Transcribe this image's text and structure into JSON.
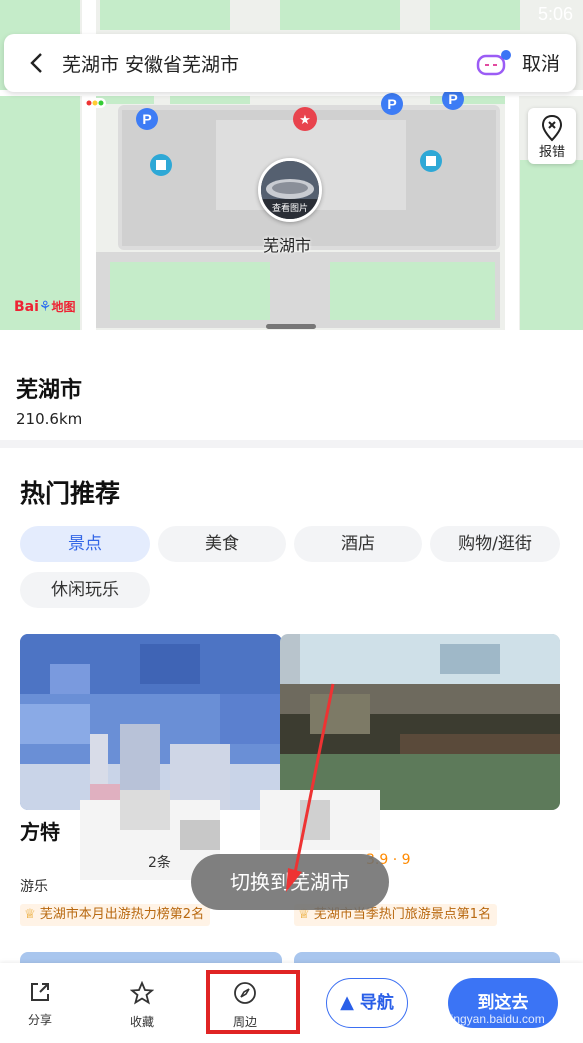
{
  "status": {
    "time": "5:06"
  },
  "search": {
    "title": "芜湖市 安徽省芜湖市",
    "cancel": "取消"
  },
  "map": {
    "report_label": "报错",
    "photo_label": "查看图片",
    "place_label": "芜湖市",
    "logo_text": "Bai地图"
  },
  "place": {
    "name": "芜湖市",
    "distance": "210.6km"
  },
  "recommend": {
    "title": "热门推荐",
    "categories": [
      "景点",
      "美食",
      "酒店",
      "购物/逛街",
      "休闲玩乐"
    ],
    "active_category": "景点"
  },
  "cards": [
    {
      "title_partial": "方特",
      "count_text": "2条",
      "type_text": "游乐",
      "rank": "芜湖市本月出游热力榜第2名"
    },
    {
      "title_partial": "",
      "rating": "3.9 · 9",
      "rank": "芜湖市当季热门旅游景点第1名"
    }
  ],
  "toast": "切换到芜湖市",
  "bottom_bar": {
    "share": "分享",
    "favorite": "收藏",
    "nearby": "周边",
    "navigate": "导航",
    "go": "到这去"
  },
  "watermark": "jingyan.baidu.com",
  "colors": {
    "accent": "#3b74f5",
    "highlight": "#e02424",
    "rank_text": "#b8680f"
  }
}
